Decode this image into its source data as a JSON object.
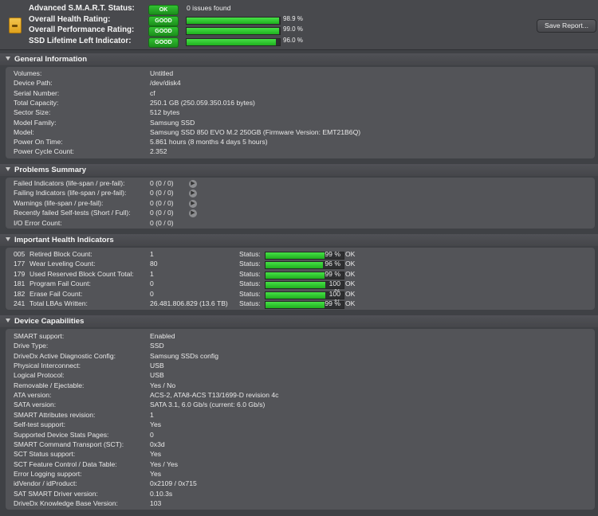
{
  "header": {
    "rows": [
      {
        "label": "Advanced S.M.A.R.T. Status:",
        "badge": "OK",
        "text": "0 issues found"
      },
      {
        "label": "Overall Health Rating:",
        "badge": "GOOD",
        "value": 0.989,
        "pct": "98.9 %"
      },
      {
        "label": "Overall Performance Rating:",
        "badge": "GOOD",
        "value": 0.99,
        "pct": "99.0 %"
      },
      {
        "label": "SSD Lifetime Left Indicator:",
        "badge": "GOOD",
        "value": 0.96,
        "pct": "96.0 %"
      }
    ],
    "save_label": "Save Report..."
  },
  "general": {
    "title": "General Information",
    "rows": [
      {
        "label": "Volumes:",
        "value": "Untitled"
      },
      {
        "label": "Device Path:",
        "value": "/dev/disk4"
      },
      {
        "label": "Serial Number:",
        "value": "cf"
      },
      {
        "label": "Total Capacity:",
        "value": "250.1 GB (250.059.350.016 bytes)"
      },
      {
        "label": "Sector Size:",
        "value": "512 bytes"
      },
      {
        "label": "Model Family:",
        "value": "Samsung SSD"
      },
      {
        "label": "Model:",
        "value": "Samsung SSD 850 EVO M.2 250GB  (Firmware Version: EMT21B6Q)"
      },
      {
        "label": "Power On Time:",
        "value": "5.861 hours (8 months 4 days 5 hours)"
      },
      {
        "label": "Power Cycle Count:",
        "value": "2.352"
      }
    ]
  },
  "problems": {
    "title": "Problems Summary",
    "rows": [
      {
        "label": "Failed Indicators (life-span / pre-fail):",
        "value": "0 (0 / 0)",
        "arrow": true
      },
      {
        "label": "Failing Indicators (life-span / pre-fail):",
        "value": "0 (0 / 0)",
        "arrow": true
      },
      {
        "label": "Warnings (life-span / pre-fail):",
        "value": "0 (0 / 0)",
        "arrow": true
      },
      {
        "label": "Recently failed Self-tests (Short / Full):",
        "value": "0 (0 / 0)",
        "arrow": true
      },
      {
        "label": "I/O Error Count:",
        "value": "0 (0 / 0)",
        "arrow": false
      }
    ]
  },
  "health": {
    "title": "Important Health Indicators",
    "status_label": "Status:",
    "rows": [
      {
        "id": "005",
        "name": "Retired Block Count:",
        "value": "1",
        "pct": "99 %",
        "level": 0.99,
        "ok": "OK"
      },
      {
        "id": "177",
        "name": "Wear Leveling Count:",
        "value": "80",
        "pct": "96 %",
        "level": 0.96,
        "ok": "OK"
      },
      {
        "id": "179",
        "name": "Used Reserved Block Count Total:",
        "value": "1",
        "pct": "99 %",
        "level": 0.99,
        "ok": "OK"
      },
      {
        "id": "181",
        "name": "Program Fail Count:",
        "value": "0",
        "pct": "100 %",
        "level": 1.0,
        "ok": "OK"
      },
      {
        "id": "182",
        "name": "Erase Fail Count:",
        "value": "0",
        "pct": "100 %",
        "level": 1.0,
        "ok": "OK"
      },
      {
        "id": "241",
        "name": "Total LBAs Written:",
        "value": "26.481.806.829 (13.6 TB)",
        "pct": "99 %",
        "level": 0.99,
        "ok": "OK"
      }
    ]
  },
  "capabilities": {
    "title": "Device Capabilities",
    "rows": [
      {
        "label": "SMART support:",
        "value": "Enabled"
      },
      {
        "label": "Drive Type:",
        "value": "SSD"
      },
      {
        "label": "DriveDx Active Diagnostic Config:",
        "value": "Samsung SSDs config"
      },
      {
        "label": "Physical Interconnect:",
        "value": "USB"
      },
      {
        "label": "Logical Protocol:",
        "value": "USB"
      },
      {
        "label": "Removable / Ejectable:",
        "value": "Yes / No"
      },
      {
        "label": "ATA version:",
        "value": "ACS-2, ATA8-ACS T13/1699-D revision 4c"
      },
      {
        "label": "SATA version:",
        "value": "SATA 3.1, 6.0 Gb/s (current: 6.0 Gb/s)"
      },
      {
        "label": "SMART Attributes revision:",
        "value": "1"
      },
      {
        "label": "Self-test support:",
        "value": "Yes"
      },
      {
        "label": "Supported Device Stats Pages:",
        "value": "0"
      },
      {
        "label": "SMART Command Transport (SCT):",
        "value": "0x3d"
      },
      {
        "label": "SCT Status support:",
        "value": "Yes"
      },
      {
        "label": "SCT Feature Control / Data Table:",
        "value": "Yes / Yes"
      },
      {
        "label": "Error Logging support:",
        "value": "Yes"
      },
      {
        "label": "idVendor / idProduct:",
        "value": "0x2109 / 0x715"
      },
      {
        "label": "SAT SMART Driver version:",
        "value": "0.10.3s"
      },
      {
        "label": "DriveDx Knowledge Base Version:",
        "value": "103"
      }
    ]
  }
}
